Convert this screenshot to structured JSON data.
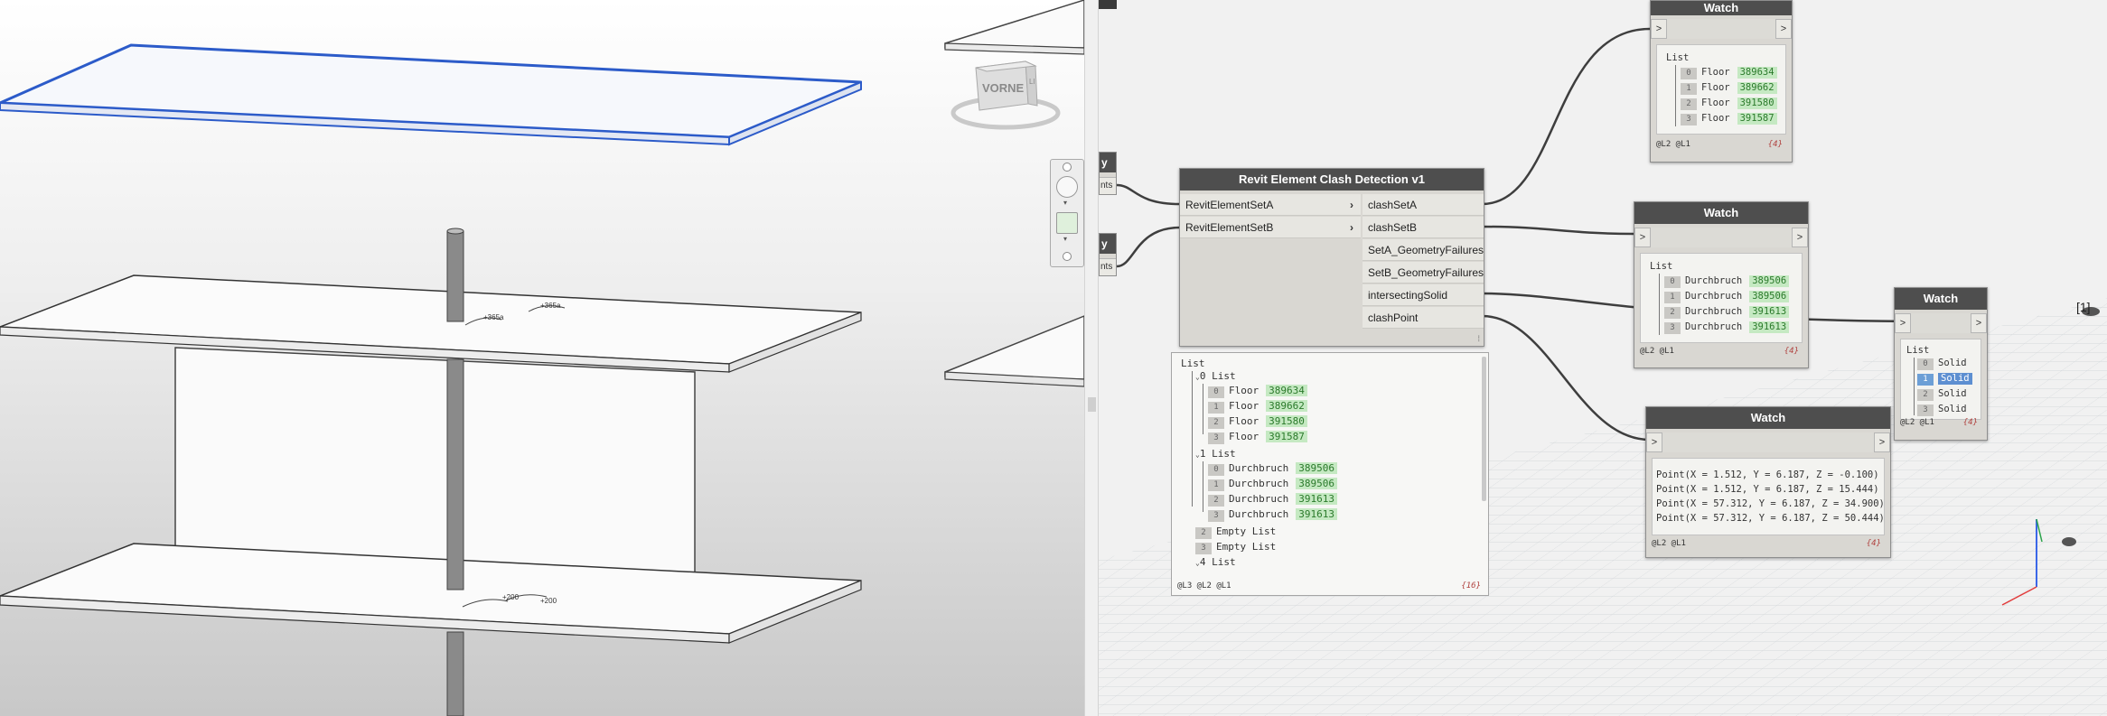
{
  "revit": {
    "viewcube_face": "VORNE",
    "viewcube_side": "LI",
    "dimension_labels": [
      "+365a",
      "+365a",
      "+200",
      "+200"
    ]
  },
  "nodes": {
    "clash_detection": {
      "title": "Revit Element Clash Detection v1",
      "inputs": [
        "RevitElementSetA",
        "RevitElementSetB"
      ],
      "outputs": [
        "clashSetA",
        "clashSetB",
        "SetA_GeometryFailures",
        "SetB_GeometryFailures",
        "intersectingSolid",
        "clashPoint"
      ],
      "preview_footer": "@L3 @L2 @L1",
      "preview_count": "{16}",
      "preview": {
        "root": "List",
        "groups": [
          {
            "index": "0",
            "label": "List",
            "items": [
              {
                "i": "0",
                "type": "Floor",
                "id": "389634"
              },
              {
                "i": "1",
                "type": "Floor",
                "id": "389662"
              },
              {
                "i": "2",
                "type": "Floor",
                "id": "391580"
              },
              {
                "i": "3",
                "type": "Floor",
                "id": "391587"
              }
            ]
          },
          {
            "index": "1",
            "label": "List",
            "items": [
              {
                "i": "0",
                "type": "Durchbruch",
                "id": "389506"
              },
              {
                "i": "1",
                "type": "Durchbruch",
                "id": "389506"
              },
              {
                "i": "2",
                "type": "Durchbruch",
                "id": "391613"
              },
              {
                "i": "3",
                "type": "Durchbruch",
                "id": "391613"
              }
            ]
          }
        ],
        "empty": [
          {
            "i": "2",
            "label": "Empty List"
          },
          {
            "i": "3",
            "label": "Empty List"
          }
        ],
        "last": {
          "i": "4",
          "label": "List"
        }
      }
    },
    "stub_a": {
      "title": "y",
      "port": "nts"
    },
    "stub_b": {
      "title": "y",
      "port": "nts"
    },
    "watch1": {
      "title": "Watch",
      "in": ">",
      "out": ">",
      "list": "List",
      "items": [
        {
          "i": "0",
          "type": "Floor",
          "id": "389634"
        },
        {
          "i": "1",
          "type": "Floor",
          "id": "389662"
        },
        {
          "i": "2",
          "type": "Floor",
          "id": "391580"
        },
        {
          "i": "3",
          "type": "Floor",
          "id": "391587"
        }
      ],
      "footer": "@L2 @L1",
      "count": "{4}"
    },
    "watch2": {
      "title": "Watch",
      "in": ">",
      "out": ">",
      "list": "List",
      "items": [
        {
          "i": "0",
          "type": "Durchbruch",
          "id": "389506"
        },
        {
          "i": "1",
          "type": "Durchbruch",
          "id": "389506"
        },
        {
          "i": "2",
          "type": "Durchbruch",
          "id": "391613"
        },
        {
          "i": "3",
          "type": "Durchbruch",
          "id": "391613"
        }
      ],
      "footer": "@L2 @L1",
      "count": "{4}"
    },
    "watch3": {
      "title": "Watch",
      "in": ">",
      "out": ">",
      "points": [
        "Point(X = 1.512, Y = 6.187, Z = -0.100)",
        "Point(X = 1.512, Y = 6.187, Z = 15.444)",
        "Point(X = 57.312, Y = 6.187, Z = 34.900)",
        "Point(X = 57.312, Y = 6.187, Z = 50.444)"
      ],
      "footer": "@L2 @L1",
      "count": "{4}"
    },
    "watch4": {
      "title": "Watch",
      "in": ">",
      "out": ">",
      "list": "List",
      "items": [
        {
          "i": "0",
          "type": "Solid"
        },
        {
          "i": "1",
          "type": "Solid"
        },
        {
          "i": "2",
          "type": "Solid"
        },
        {
          "i": "3",
          "type": "Solid"
        }
      ],
      "selected_index": 1,
      "footer": "@L2 @L1",
      "count": "{4}"
    }
  },
  "background_preview_label": "[1]"
}
